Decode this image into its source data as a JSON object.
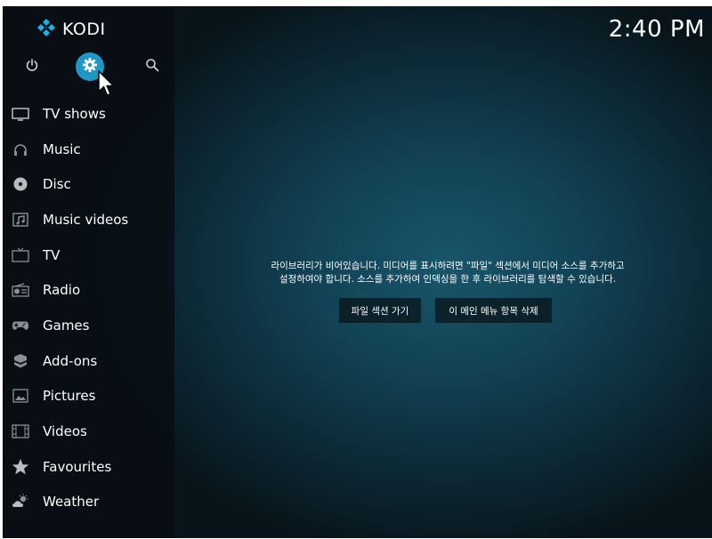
{
  "app": {
    "name": "KODI"
  },
  "header": {
    "clock": "2:40 PM"
  },
  "topbar": {
    "icons": [
      "power-icon",
      "settings-icon",
      "search-icon"
    ]
  },
  "menu": {
    "items": [
      {
        "label": "TV shows",
        "icon": "tv-icon"
      },
      {
        "label": "Music",
        "icon": "headphones-icon"
      },
      {
        "label": "Disc",
        "icon": "disc-icon"
      },
      {
        "label": "Music videos",
        "icon": "music-video-icon"
      },
      {
        "label": "TV",
        "icon": "tv-outline-icon"
      },
      {
        "label": "Radio",
        "icon": "radio-icon"
      },
      {
        "label": "Games",
        "icon": "gamepad-icon"
      },
      {
        "label": "Add-ons",
        "icon": "addons-icon"
      },
      {
        "label": "Pictures",
        "icon": "pictures-icon"
      },
      {
        "label": "Videos",
        "icon": "film-icon"
      },
      {
        "label": "Favourites",
        "icon": "star-icon"
      },
      {
        "label": "Weather",
        "icon": "weather-icon"
      }
    ]
  },
  "main": {
    "message_line1": "라이브러리가 비어있습니다. 미디어를 표시하려면 \"파일\" 섹션에서 미디어 소스를 추가하고",
    "message_line2": "설정하여야 합니다. 소스를 추가하여 인덱싱을 한 후 라이브러리를 탐색할 수 있습니다.",
    "button_files": "파일 섹션 가기",
    "button_remove": "이 메인 메뉴 항목 삭제"
  },
  "colors": {
    "accent": "#1f97c4",
    "kodi_blue": "#17b2e7",
    "icon_gray": "#8a9196"
  }
}
